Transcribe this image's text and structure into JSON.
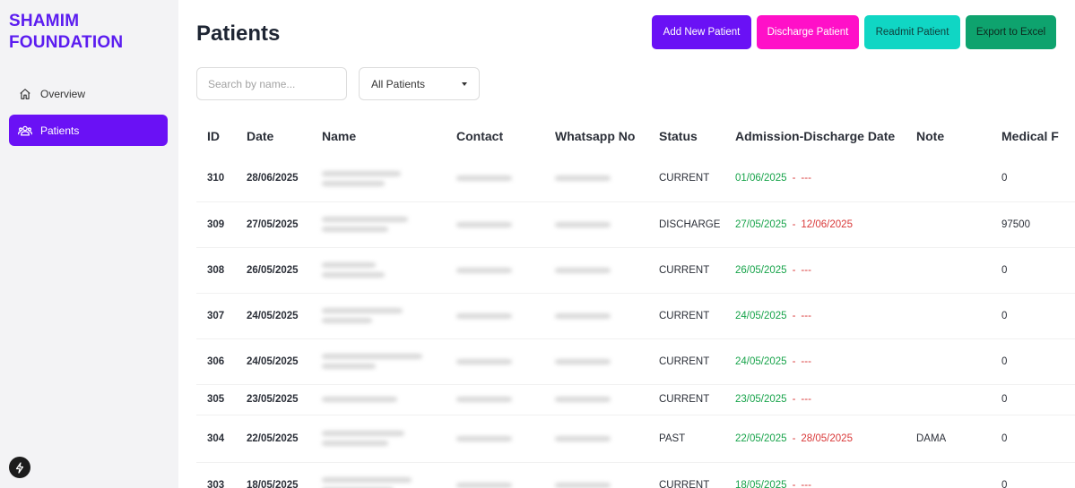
{
  "sidebar": {
    "brand_line1": "SHAMIM",
    "brand_line2": "FOUNDATION",
    "items": [
      {
        "label": "Overview",
        "icon": "home-icon",
        "active": false
      },
      {
        "label": "Patients",
        "icon": "users-icon",
        "active": true
      }
    ],
    "footer_icon": "bolt-icon"
  },
  "header": {
    "title": "Patients",
    "buttons": {
      "add": "Add New Patient",
      "discharge": "Discharge Patient",
      "readmit": "Readmit Patient",
      "export": "Export to Excel"
    }
  },
  "filters": {
    "search_placeholder": "Search by name...",
    "status_selected": "All Patients"
  },
  "table": {
    "columns": [
      "ID",
      "Date",
      "Name",
      "Contact",
      "Whatsapp No",
      "Status",
      "Admission-Discharge Date",
      "Note",
      "Medical F"
    ],
    "rows": [
      {
        "id": "310",
        "date": "28/06/2025",
        "status": "CURRENT",
        "admission": "01/06/2025",
        "discharge": "---",
        "note": "",
        "medical": "0"
      },
      {
        "id": "309",
        "date": "27/05/2025",
        "status": "DISCHARGE",
        "admission": "27/05/2025",
        "discharge": "12/06/2025",
        "note": "",
        "medical": "97500"
      },
      {
        "id": "308",
        "date": "26/05/2025",
        "status": "CURRENT",
        "admission": "26/05/2025",
        "discharge": "---",
        "note": "",
        "medical": "0"
      },
      {
        "id": "307",
        "date": "24/05/2025",
        "status": "CURRENT",
        "admission": "24/05/2025",
        "discharge": "---",
        "note": "",
        "medical": "0"
      },
      {
        "id": "306",
        "date": "24/05/2025",
        "status": "CURRENT",
        "admission": "24/05/2025",
        "discharge": "---",
        "note": "",
        "medical": "0"
      },
      {
        "id": "305",
        "date": "23/05/2025",
        "status": "CURRENT",
        "admission": "23/05/2025",
        "discharge": "---",
        "note": "",
        "medical": "0"
      },
      {
        "id": "304",
        "date": "22/05/2025",
        "status": "PAST",
        "admission": "22/05/2025",
        "discharge": "28/05/2025",
        "note": "DAMA",
        "medical": "0"
      },
      {
        "id": "303",
        "date": "18/05/2025",
        "status": "CURRENT",
        "admission": "18/05/2025",
        "discharge": "---",
        "note": "",
        "medical": "0"
      }
    ],
    "separator": "-"
  },
  "colors": {
    "brand": "#5b1cf0",
    "active_nav": "#6a11f5",
    "add_button": "#6a11f5",
    "discharge_button": "#ff10c8",
    "readmit_button": "#10d6c4",
    "export_button": "#0ea36e",
    "admission_date": "#17a34a",
    "discharge_date": "#d93838"
  }
}
